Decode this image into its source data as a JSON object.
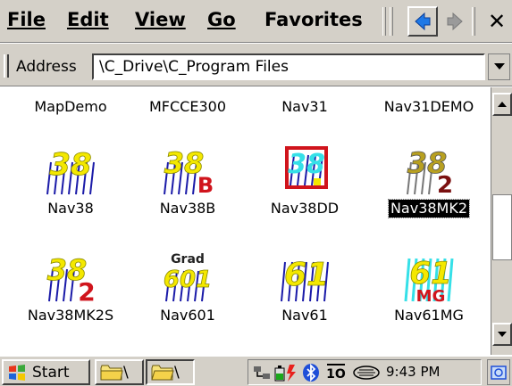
{
  "menubar": {
    "file": "File",
    "edit": "Edit",
    "view": "View",
    "go": "Go",
    "favorites": "Favorites"
  },
  "address": {
    "label": "Address",
    "value": "\\C_Drive\\C_Program Files"
  },
  "files_top_row": [
    "MapDemo",
    "MFCCE300",
    "Nav31",
    "Nav31DEMO"
  ],
  "files": [
    {
      "name": "Nav38",
      "icon": "nav38-icon"
    },
    {
      "name": "Nav38B",
      "icon": "nav38b-icon"
    },
    {
      "name": "Nav38DD",
      "icon": "nav38dd-icon"
    },
    {
      "name": "Nav38MK2",
      "icon": "nav38mk2-icon",
      "selected": true
    },
    {
      "name": "Nav38MK2S",
      "icon": "nav38mk2s-icon"
    },
    {
      "name": "Nav601",
      "icon": "nav601-icon"
    },
    {
      "name": "Nav61",
      "icon": "nav61-icon"
    },
    {
      "name": "Nav61MG",
      "icon": "nav61mg-icon"
    }
  ],
  "icon_text": {
    "n38": "38",
    "n61": "61",
    "n601": "601",
    "grad": "Grad",
    "b": "B",
    "two": "2",
    "mg": "MG"
  },
  "taskbar": {
    "start_label": "Start",
    "task1_label": "\\",
    "task2_label": "\\",
    "clock": "9:43 PM"
  },
  "colors": {
    "chrome": "#d4d0c8",
    "icon_yellow": "#f4e800",
    "icon_blue": "#1a1aa8",
    "icon_red": "#d0141c",
    "icon_cyan": "#35e0e8"
  }
}
